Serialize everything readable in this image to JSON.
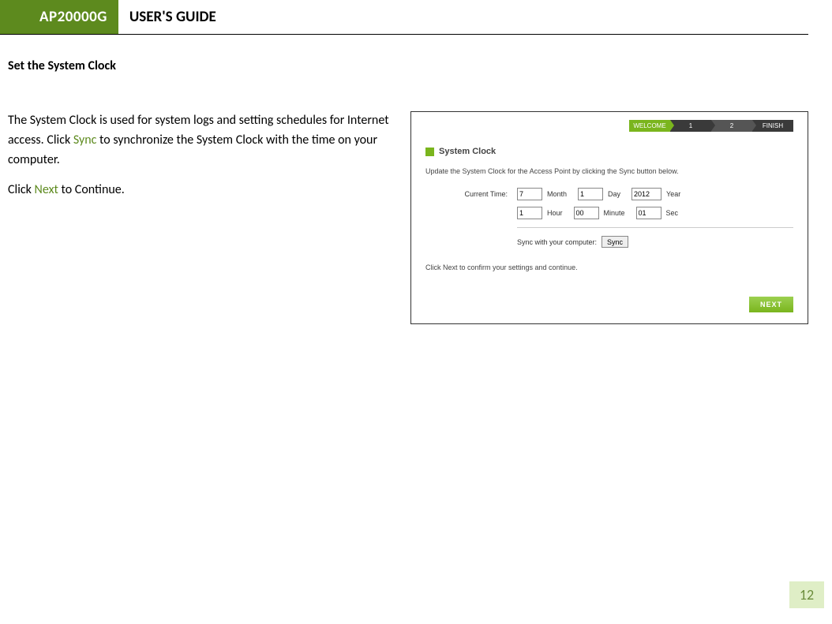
{
  "header": {
    "badge": "AP20000G",
    "title": "USER'S GUIDE"
  },
  "section_title": "Set the System Clock",
  "body": {
    "p1_a": "The System Clock is used for system logs and setting schedules for Internet access. Click ",
    "p1_link": "Sync",
    "p1_b": " to synchronize the System Clock with the time on your computer.",
    "p2_a": "Click ",
    "p2_link": "Next",
    "p2_b": " to Continue."
  },
  "wizard": {
    "steps": {
      "welcome": "WELCOME",
      "s1": "1",
      "s2": "2",
      "finish": "FINISH"
    },
    "heading": "System Clock",
    "desc": "Update the System Clock for the Access Point by clicking the Sync button below.",
    "current_time_label": "Current Time:",
    "month": "7",
    "month_label": "Month",
    "day": "1",
    "day_label": "Day",
    "year": "2012",
    "year_label": "Year",
    "hour": "1",
    "hour_label": "Hour",
    "minute": "00",
    "minute_label": "Minute",
    "sec": "01",
    "sec_label": "Sec",
    "sync_label": "Sync with your computer:",
    "sync_button": "Sync",
    "confirm": "Click Next to confirm your settings and continue.",
    "next_button": "NEXT"
  },
  "page_number": "12"
}
